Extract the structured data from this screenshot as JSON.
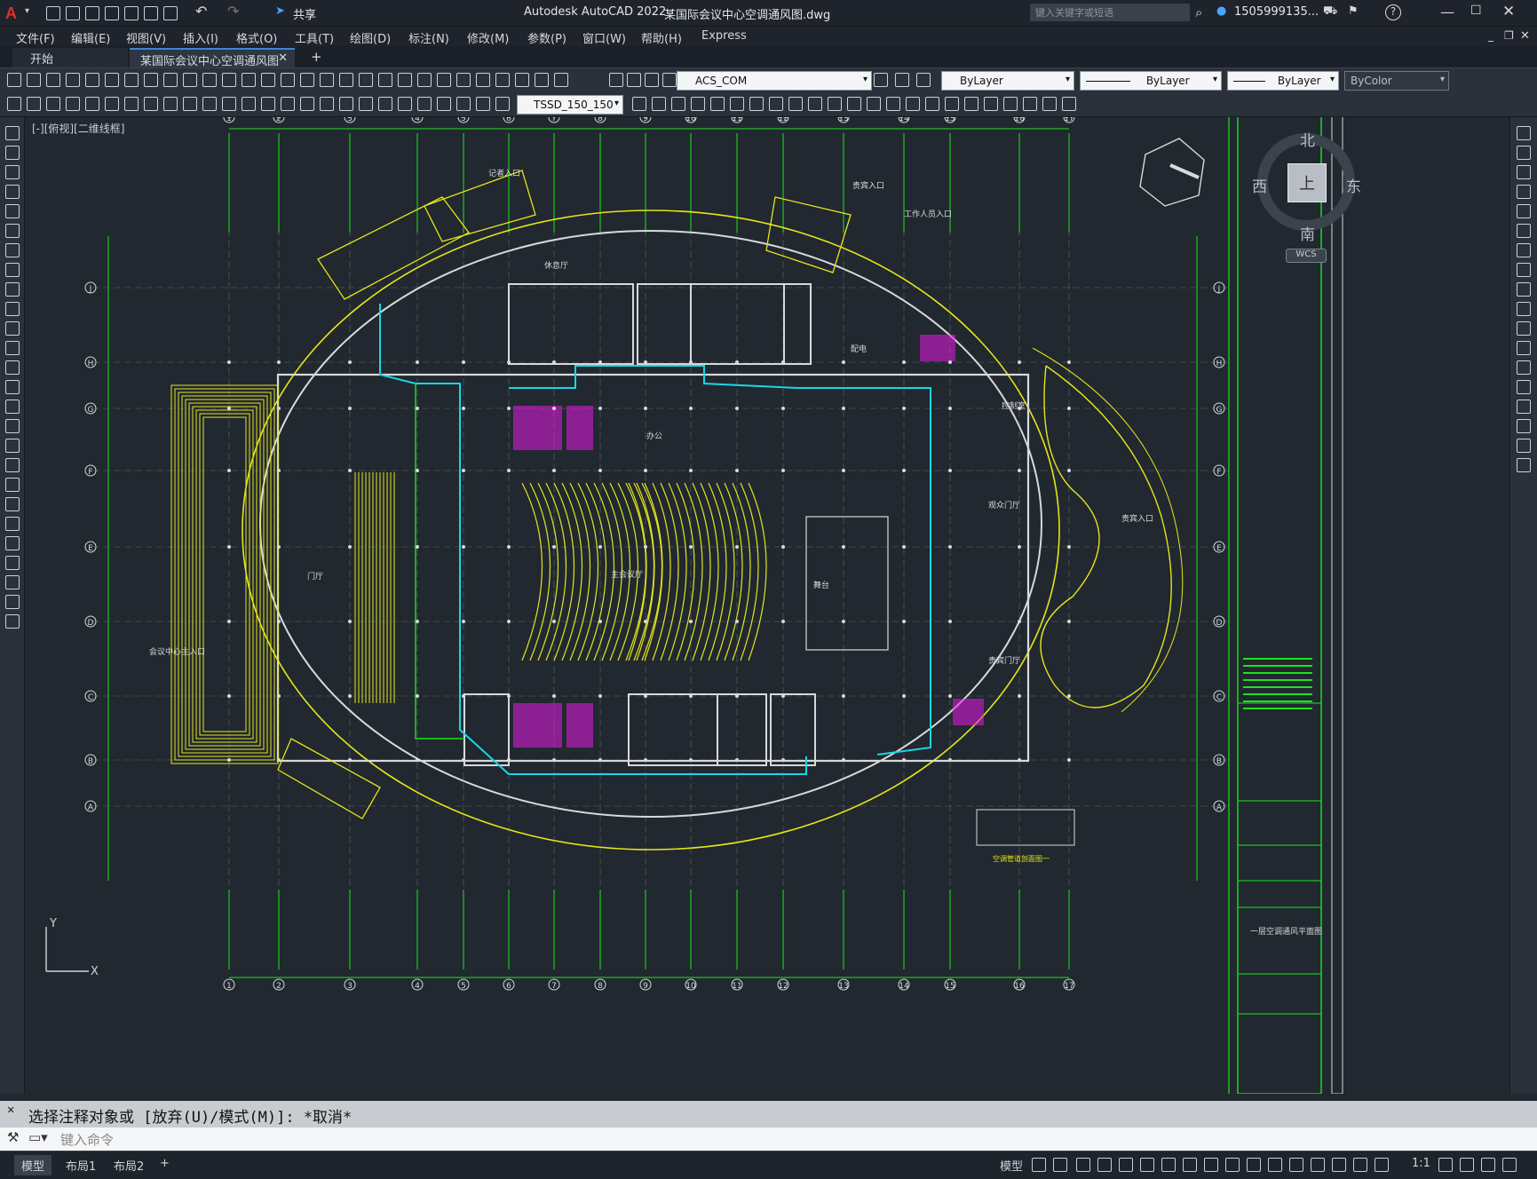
{
  "app": {
    "title": "Autodesk AutoCAD 2022",
    "file": "某国际会议中心空调通风图.dwg",
    "share": "共享",
    "search_placeholder": "键入关键字或短语",
    "user": "1505999135...",
    "help": "?"
  },
  "menu": [
    "文件(F)",
    "编辑(E)",
    "视图(V)",
    "插入(I)",
    "格式(O)",
    "工具(T)",
    "绘图(D)",
    "标注(N)",
    "修改(M)",
    "参数(P)",
    "窗口(W)",
    "帮助(H)",
    "Express"
  ],
  "tabs": {
    "start": "开始",
    "active": "某国际会议中心空调通风图*",
    "add": "+"
  },
  "toolbar": {
    "layer": "ACS_COM",
    "color": "ByLayer",
    "linetype": "ByLayer",
    "lineweight": "ByLayer",
    "plotstyle": "ByColor",
    "dimstyle": "TSSD_150_150"
  },
  "viewport": {
    "label": "[-][俯视][二维线框]",
    "compass": {
      "n": "北",
      "s": "南",
      "e": "东",
      "w": "西",
      "top": "上"
    },
    "wcs": "WCS"
  },
  "drawing": {
    "col_labels": [
      "1",
      "2",
      "3",
      "4",
      "5",
      "6",
      "7",
      "8",
      "9",
      "10",
      "11",
      "12",
      "13",
      "14",
      "15",
      "16",
      "17"
    ],
    "row_labels": [
      "J",
      "H",
      "G",
      "F",
      "E",
      "D",
      "C",
      "B",
      "A"
    ],
    "rooms": [
      "记者入口",
      "贵宾入口",
      "工作人员入口",
      "门厅",
      "会议中心主入口",
      "舞台",
      "办公",
      "观众门厅",
      "贵宾门厅",
      "贵宾入口",
      "主会议厅",
      "休息厅",
      "配电",
      "控制室"
    ],
    "title_block": "一层空调通风平面图",
    "detail_label": "空调管道剖面图一"
  },
  "command": {
    "history": "选择注释对象或 [放弃(U)/模式(M)]: *取消*",
    "placeholder": "键入命令"
  },
  "status": {
    "tabs": [
      "模型",
      "布局1",
      "布局2"
    ],
    "add": "+",
    "model": "模型",
    "scale": "1:1"
  }
}
